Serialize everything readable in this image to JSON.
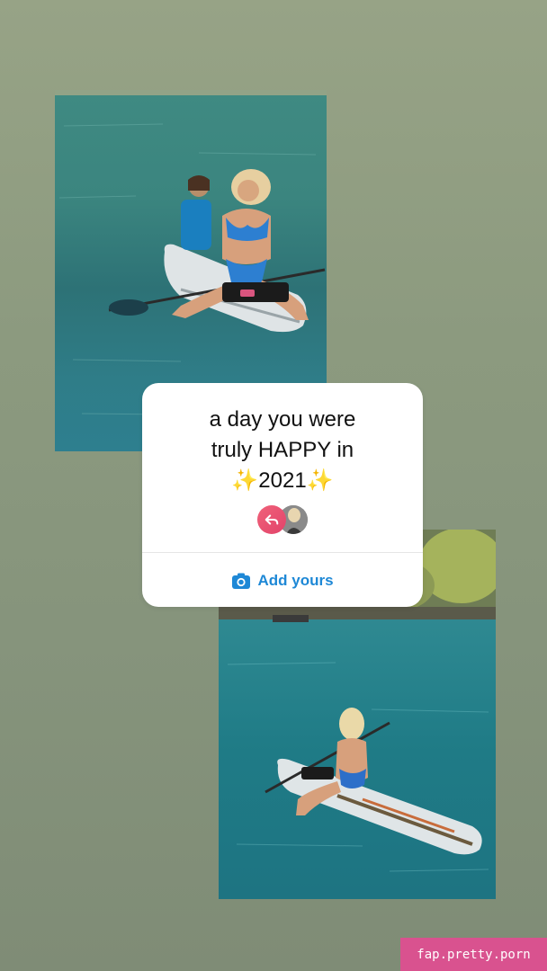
{
  "story": {
    "prompt_lines": [
      "a day you were",
      "truly HAPPY in",
      "✨2021✨"
    ],
    "add_yours_label": "Add yours",
    "watermark": "fap.pretty.porn"
  },
  "icons": {
    "reply": "reply-arrow-icon",
    "camera": "camera-icon"
  },
  "colors": {
    "accent": "#1e88d6",
    "reply_avatar": "#e94b6f",
    "watermark_bg": "#d9528f"
  }
}
